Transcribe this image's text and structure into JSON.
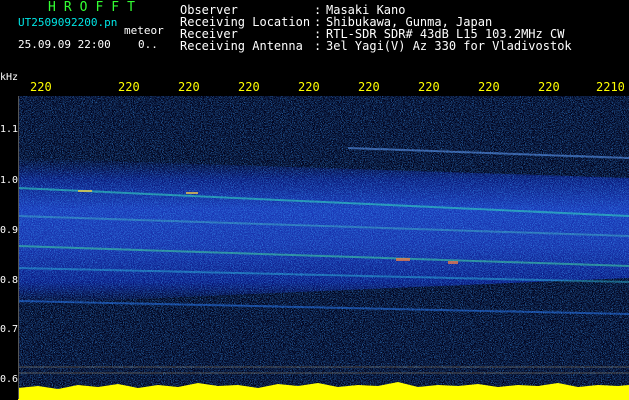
{
  "header": {
    "title": "HROFFT",
    "filename": "UT2509092200.pn",
    "meteor_label": "meteor",
    "datetime": "25.09.09 22:00",
    "count": "0..",
    "info": [
      {
        "label": "Observer",
        "sep": ":",
        "value": "Masaki Kano"
      },
      {
        "label": "Receiving Location",
        "sep": ":",
        "value": "Shibukawa, Gunma, Japan"
      },
      {
        "label": "Receiver",
        "sep": ":",
        "value": "RTL-SDR SDR# 43dB L15 103.2MHz CW"
      },
      {
        "label": "Receiving Antenna",
        "sep": ":",
        "value": "3el Yagi(V) Az 330 for Vladivostok"
      }
    ]
  },
  "axis": {
    "unit": "kHz",
    "time_ticks": [
      "220",
      "220",
      "220",
      "220",
      "220",
      "220",
      "220",
      "220",
      "220",
      "2210"
    ],
    "freq_labels": [
      "1.1",
      "1.0",
      "0.9",
      "0.8",
      "0.7",
      "0.6"
    ]
  },
  "colors": {
    "tick": "#ffff00",
    "title": "#33ff33",
    "filename": "#00e5e5",
    "background": "#000000"
  }
}
